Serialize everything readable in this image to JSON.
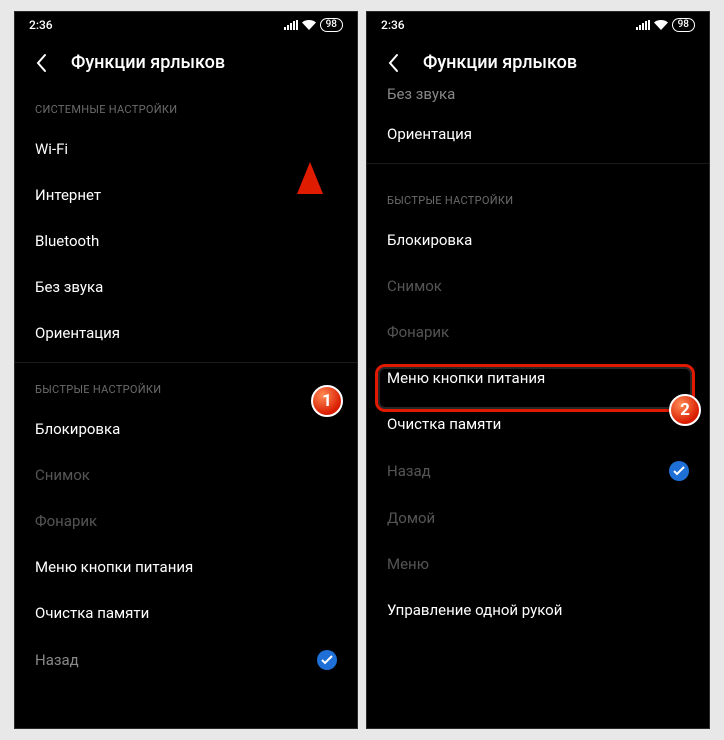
{
  "statusbar": {
    "time": "2:36",
    "battery": "98"
  },
  "header": {
    "title": "Функции ярлыков"
  },
  "screen1": {
    "section1_label": "СИСТЕМНЫЕ НАСТРОЙКИ",
    "items1": {
      "wifi": "Wi-Fi",
      "internet": "Интернет",
      "bluetooth": "Bluetooth",
      "silent": "Без звука",
      "orientation": "Ориентация"
    },
    "section2_label": "БЫСТРЫЕ НАСТРОЙКИ",
    "items2": {
      "lock": "Блокировка",
      "screenshot": "Снимок",
      "flashlight": "Фонарик",
      "power_menu": "Меню кнопки питания",
      "memory_clean": "Очистка памяти",
      "back": "Назад"
    }
  },
  "screen2": {
    "top_item": "Без звука",
    "orientation": "Ориентация",
    "section2_label": "БЫСТРЫЕ НАСТРОЙКИ",
    "items2": {
      "lock": "Блокировка",
      "screenshot": "Снимок",
      "flashlight": "Фонарик",
      "power_menu": "Меню кнопки питания",
      "memory_clean": "Очистка памяти",
      "back": "Назад",
      "home": "Домой",
      "menu": "Меню",
      "onehand": "Управление одной рукой"
    }
  },
  "annotations": {
    "step1": "1",
    "step2": "2"
  }
}
